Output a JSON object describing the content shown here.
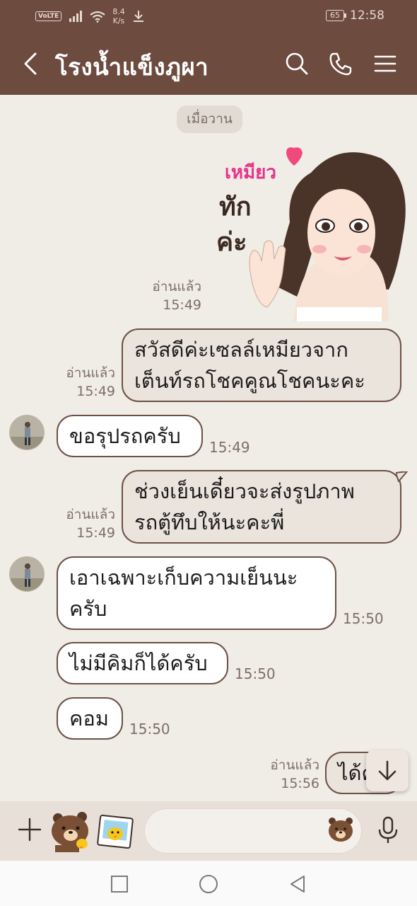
{
  "status_bar": {
    "volte": "VoLTE",
    "net_speed_value": "8.4",
    "net_speed_unit": "K/s",
    "battery": "65",
    "time": "12:58"
  },
  "header": {
    "title": "โรงน้ำแข็งภูผา"
  },
  "chat": {
    "date_divider": "เมื่อวาน",
    "sticker_text": {
      "line1": "เหมียว",
      "line2": "ทัก",
      "line3": "ค่ะ"
    },
    "messages": [
      {
        "direction": "out",
        "type": "sticker",
        "read": "อ่านแล้ว",
        "time": "15:49"
      },
      {
        "direction": "out",
        "lines": [
          "สวัสดีค่ะเซลล์เหมียวจาก",
          "เต็นท์รถโชคคูณโชคนะคะ"
        ],
        "read": "อ่านแล้ว",
        "time": "15:49"
      },
      {
        "direction": "in",
        "lines": [
          "ขอรุปรถครับ"
        ],
        "time": "15:49"
      },
      {
        "direction": "out",
        "lines": [
          "ช่วงเย็นเดี๋ยวจะส่งรูปภาพ",
          "รถตู้ทึบให้นะคะพี่"
        ],
        "read": "อ่านแล้ว",
        "time": "15:49"
      },
      {
        "direction": "in",
        "lines": [
          "เอาเฉพาะเก็บความเย็นนะ",
          "ครับ"
        ],
        "time": "15:50"
      },
      {
        "direction": "in",
        "lines": [
          "ไม่มีคิมก็ได้ครับ"
        ],
        "time": "15:50"
      },
      {
        "direction": "in",
        "lines": [
          "คอม"
        ],
        "time": "15:50"
      },
      {
        "direction": "out",
        "lines": [
          "ได้ค่"
        ],
        "read": "อ่านแล้ว",
        "time": "15:56"
      }
    ]
  },
  "input": {
    "placeholder": ""
  },
  "icons": {
    "back": "chevron-left-icon",
    "search": "search-icon",
    "call": "phone-icon",
    "menu": "menu-icon",
    "plus": "plus-icon",
    "sticker": "sticker-icon",
    "photo": "photo-icon",
    "emoji": "emoji-icon",
    "mic": "mic-icon",
    "scroll": "arrow-down-icon",
    "nav_recent": "square-icon",
    "nav_home": "circle-icon",
    "nav_back": "triangle-back-icon"
  },
  "colors": {
    "header": "#6d4b3f",
    "chat_bg": "#f0ece6",
    "bubble_out": "#ebe4dd",
    "bubble_in": "#ffffff",
    "bubble_border": "#6d5145",
    "input_bar": "#e8e0d8"
  }
}
